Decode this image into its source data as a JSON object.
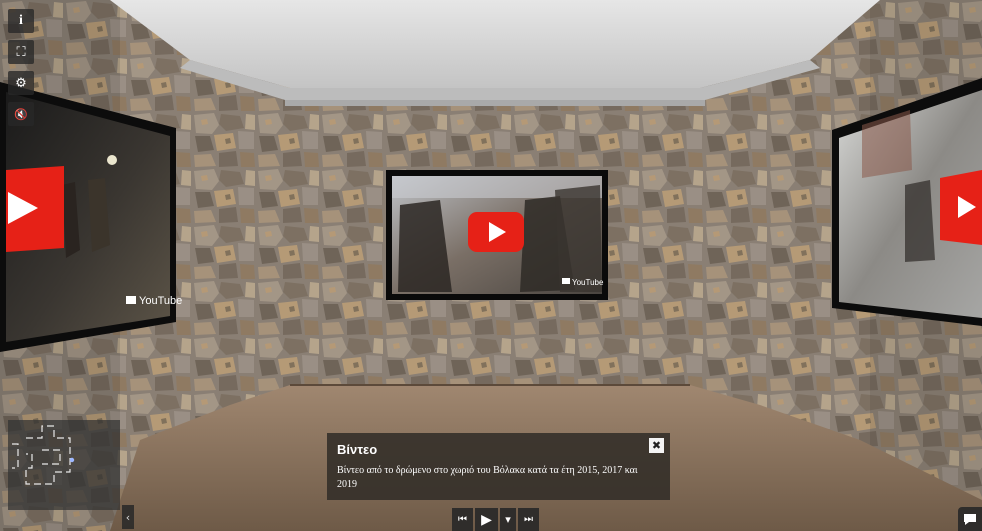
{
  "toolbar": {
    "info_icon": "i",
    "fullscreen_icon": "⛶",
    "settings_icon": "⚙",
    "mute_icon": "🔇"
  },
  "videos": {
    "left": {
      "logo_text": "YouTube"
    },
    "center": {
      "logo_text": "YouTube"
    },
    "right": {
      "logo_text": ""
    }
  },
  "info_panel": {
    "title": "Βίντεο",
    "description": "Βίντεο από το δρώμενο στο χωριό του Βόλακα κατά τα έτη 2015, 2017 και 2019",
    "close_icon": "✖"
  },
  "minimap": {
    "toggle_icon": "‹"
  },
  "player": {
    "prev_icon": "⏮",
    "play_icon": "▶",
    "dropdown_icon": "▾",
    "next_icon": "⏭"
  },
  "colors": {
    "youtube_red": "#e62117",
    "ceiling": "#d8d8d8",
    "floor": "#8a7560",
    "wall_mortar": "#8a7f74"
  }
}
